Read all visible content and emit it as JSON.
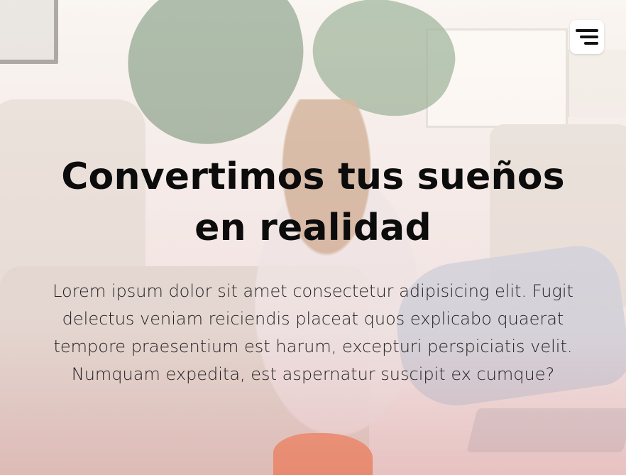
{
  "hero": {
    "title": "Convertimos tus sueños en realidad",
    "subtitle": "Lorem ipsum dolor sit amet consectetur adipisicing elit. Fugit delectus veniam reiciendis placeat quos explicabo quaerat tempore praesentium est harum, excepturi perspiciatis velit. Numquam expedita, est aspernatur suscipit ex cumque?"
  },
  "menu": {
    "icon": "hamburger-menu-icon"
  }
}
